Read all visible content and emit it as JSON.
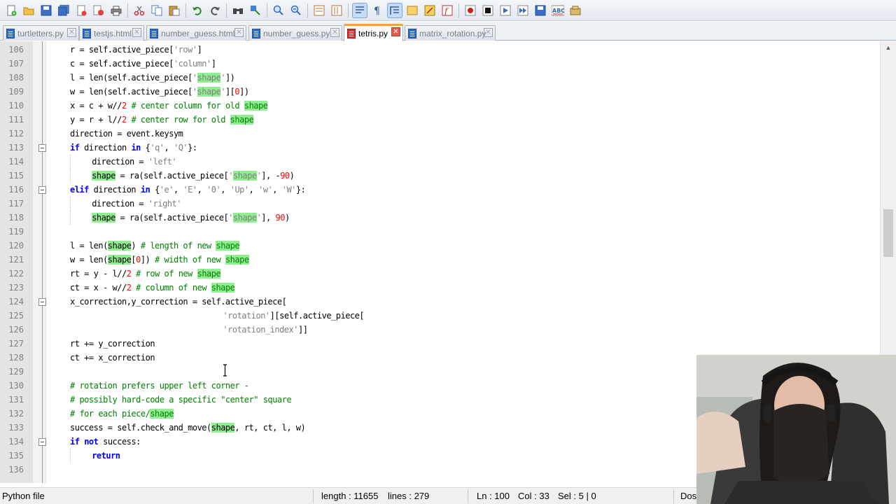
{
  "tabs": [
    {
      "label": "turtletters.py",
      "active": false,
      "icon": "python-file-icon"
    },
    {
      "label": "testjs.html",
      "active": false,
      "icon": "html-file-icon"
    },
    {
      "label": "number_guess.html",
      "active": false,
      "icon": "html-file-icon"
    },
    {
      "label": "number_guess.py",
      "active": false,
      "icon": "python-file-icon"
    },
    {
      "label": "tetris.py",
      "active": true,
      "icon": "modified-file-icon"
    },
    {
      "label": "matrix_rotation.py",
      "active": false,
      "icon": "python-file-icon"
    }
  ],
  "editor": {
    "line_numbers": [
      "106",
      "107",
      "108",
      "109",
      "110",
      "111",
      "112",
      "113",
      "114",
      "115",
      "116",
      "117",
      "118",
      "119",
      "120",
      "121",
      "122",
      "123",
      "124",
      "125",
      "126",
      "127",
      "128",
      "129",
      "130",
      "131",
      "132",
      "133",
      "134",
      "135",
      "136"
    ],
    "folded_lines": [
      "113",
      "116",
      "124",
      "134"
    ],
    "lines": [
      "r = self.active_piece['row']",
      "c = self.active_piece['column']",
      "l = len(self.active_piece['shape'])",
      "w = len(self.active_piece['shape'][0])",
      "x = c + w//2 # center column for old shape",
      "y = r + l//2 # center row for old shape",
      "direction = event.keysym",
      "if direction in {'q', 'Q'}:",
      "direction = 'left'",
      "shape = ra(self.active_piece['shape'], -90)",
      "elif direction in {'e', 'E', '0', 'Up', 'w', 'W'}:",
      "direction = 'right'",
      "shape = ra(self.active_piece['shape'], 90)",
      "",
      "l = len(shape) # length of new shape",
      "w = len(shape[0]) # width of new shape",
      "rt = y - l//2 # row of new shape",
      "ct = x - w//2 # column of new shape",
      "x_correction,y_correction = self.active_piece[",
      "'rotation'][self.active_piece[",
      "'rotation_index']]",
      "rt += y_correction",
      "ct += x_correction",
      "",
      "# rotation prefers upper left corner -",
      "# possibly hard-code a specific \"center\" square",
      "# for each piece/shape",
      "success = self.check_and_move(shape, rt, ct, l, w)",
      "if not success:",
      "return",
      ""
    ]
  },
  "status": {
    "file_type": "Python file",
    "length": "length : 11655",
    "lines": "lines : 279",
    "ln": "Ln : 100",
    "col": "Col : 33",
    "sel": "Sel : 5 | 0",
    "eol": "Dos"
  },
  "colors": {
    "keyword": "#0000ff",
    "string": "#808080",
    "number": "#ff0000",
    "comment": "#008000",
    "highlight": "#90ee90",
    "active_tab_accent": "#f2a14b"
  },
  "toolbar_icons": [
    "new-file-icon",
    "open-file-icon",
    "save-icon",
    "save-all-icon",
    "close-icon",
    "close-all-icon",
    "print-icon",
    "cut-icon",
    "copy-icon",
    "paste-icon",
    "undo-icon",
    "redo-icon",
    "find-icon",
    "replace-icon",
    "zoom-in-icon",
    "zoom-out-icon",
    "sync-vertical-icon",
    "sync-horizontal-icon",
    "word-wrap-icon",
    "show-all-chars-icon",
    "indent-guide-icon",
    "doc-map-icon",
    "function-list-icon",
    "folder-workspace-icon",
    "record-macro-icon",
    "stop-macro-icon",
    "play-macro-icon",
    "run-macro-multiple-icon",
    "save-macro-icon",
    "spell-check-icon",
    "plugin-icon"
  ]
}
